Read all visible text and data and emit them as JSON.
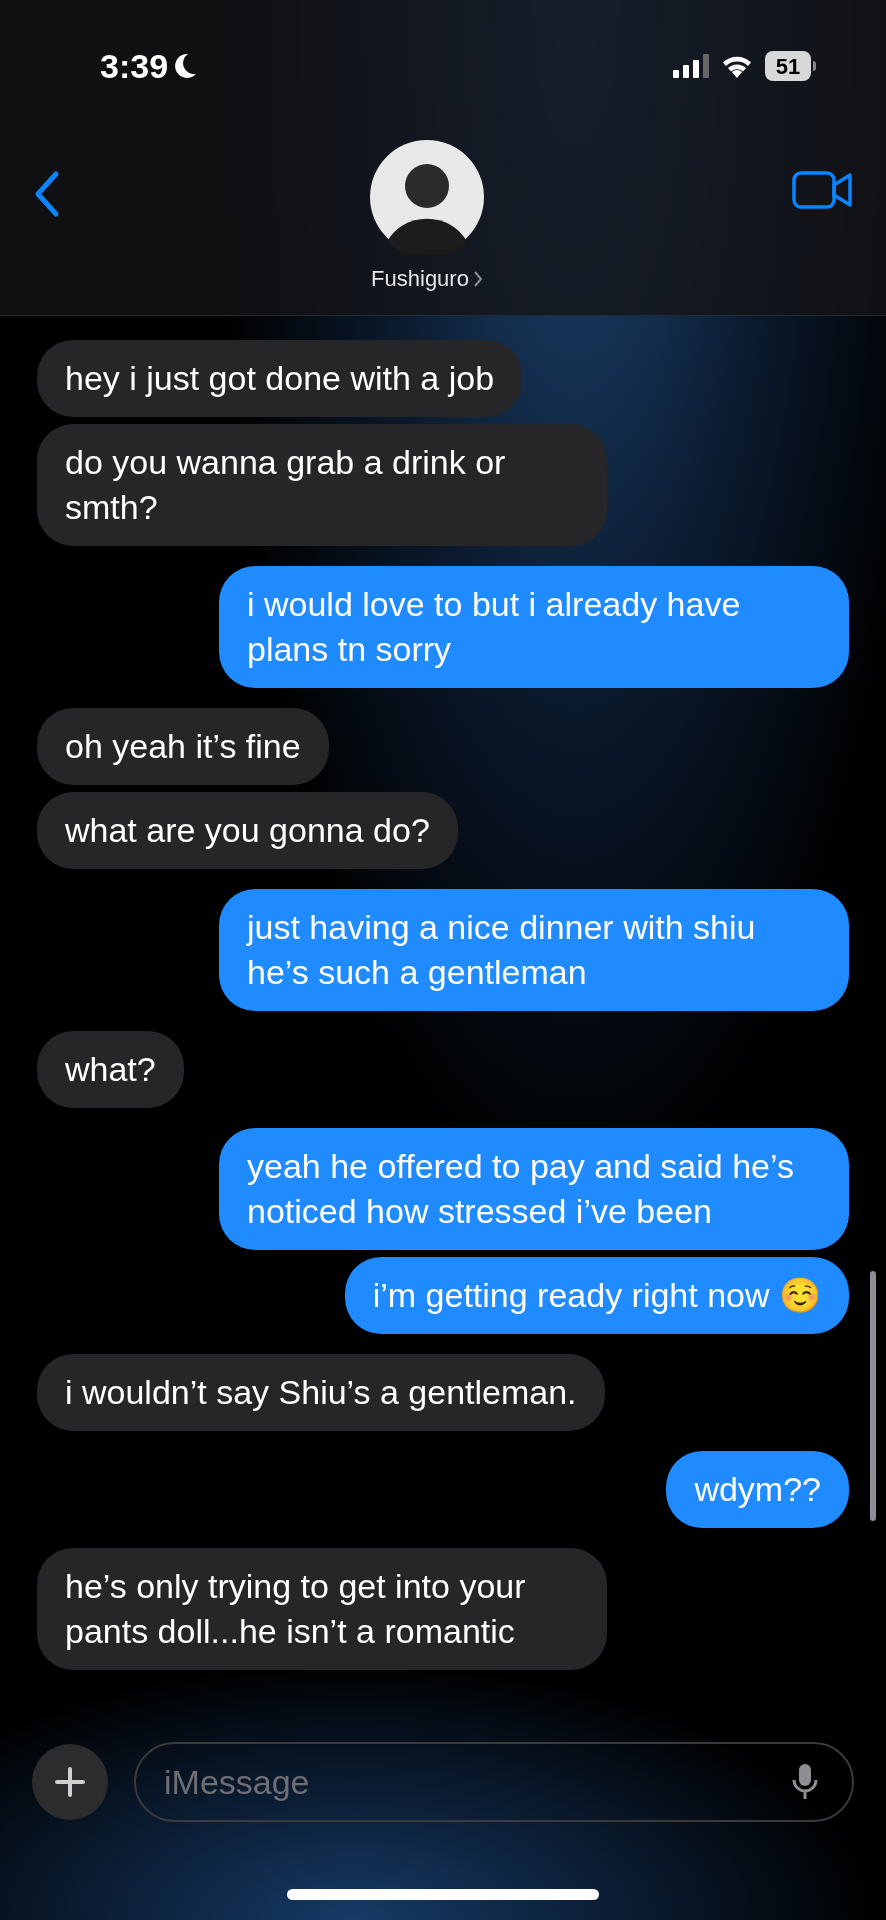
{
  "status_bar": {
    "time": "3:39",
    "battery": "51"
  },
  "header": {
    "contact_name": "Fushiguro"
  },
  "messages": [
    {
      "kind": "received",
      "text": "hey i just got done with a job"
    },
    {
      "kind": "received",
      "text": "do you wanna grab a drink or smth?"
    },
    {
      "kind": "sent",
      "text": "i would love to but i already have plans tn sorry"
    },
    {
      "kind": "received",
      "text": "oh yeah it’s fine"
    },
    {
      "kind": "received",
      "text": "what are you gonna do?"
    },
    {
      "kind": "sent",
      "text": "just having a nice dinner with shiu he’s such a gentleman"
    },
    {
      "kind": "received",
      "text": "what?"
    },
    {
      "kind": "sent",
      "text": "yeah he offered to pay and said he’s noticed how stressed i’ve been"
    },
    {
      "kind": "sent",
      "text": "i’m getting ready right now ☺️"
    },
    {
      "kind": "received",
      "text": "i wouldn’t say Shiu’s a gentleman."
    },
    {
      "kind": "sent",
      "text": "wdym??"
    },
    {
      "kind": "received",
      "text": "he’s only trying to get into your pants doll...he isn’t a romantic"
    }
  ],
  "composer": {
    "placeholder": "iMessage"
  }
}
